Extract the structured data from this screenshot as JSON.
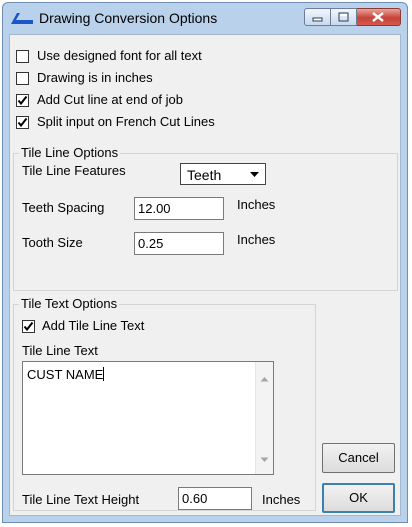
{
  "window": {
    "title": "Drawing Conversion Options",
    "icons": {
      "app": "logo-icon",
      "minimize": "minimize-icon",
      "maximize": "maximize-icon",
      "close": "close-icon"
    },
    "colors": {
      "frame": "#b9d1ea",
      "client": "#f0f0f0",
      "close_button": "#c7433a"
    }
  },
  "options": [
    {
      "label": "Use designed font for all text",
      "checked": false
    },
    {
      "label": "Drawing is in inches",
      "checked": false
    },
    {
      "label": "Add Cut line at end of job",
      "checked": true
    },
    {
      "label": "Split input on French Cut Lines",
      "checked": true
    }
  ],
  "tile_line": {
    "group_label": "Tile Line Options",
    "features_label": "Tile Line Features",
    "features_value": "Teeth",
    "spacing_label": "Teeth Spacing",
    "spacing_value": "12.00",
    "spacing_unit": "Inches",
    "size_label": "Tooth Size",
    "size_value": "0.25",
    "size_unit": "Inches"
  },
  "tile_text": {
    "group_label": "Tile Text Options",
    "add_label": "Add Tile Line Text",
    "add_checked": true,
    "text_label": "Tile Line Text",
    "text_value": "CUST NAME",
    "height_label": "Tile Line Text Height",
    "height_value": "0.60",
    "height_unit": "Inches"
  },
  "buttons": {
    "cancel": "Cancel",
    "ok": "OK"
  }
}
